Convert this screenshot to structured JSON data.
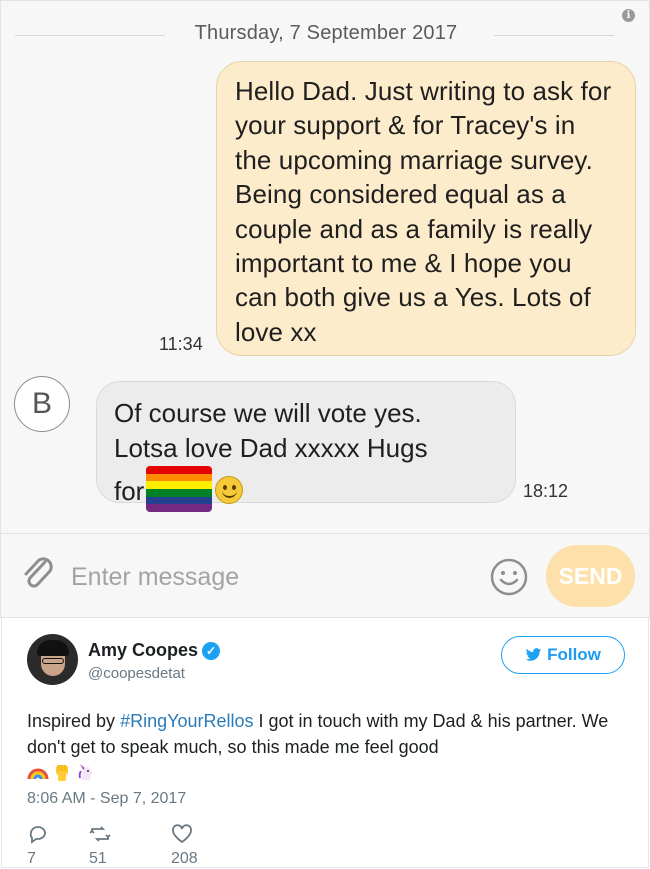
{
  "conversation": {
    "date_label": "Thursday, 7 September 2017",
    "outgoing": {
      "text": "Hello Dad. Just writing to ask for your support & for Tracey's in the upcoming marriage survey. Being considered equal as a couple and as a family is really important to me & I hope you can both give us a Yes. Lots of love xx",
      "time": "11:34"
    },
    "incoming": {
      "avatar_letter": "B",
      "text_line1": "Of course  we will  vote yes.",
      "text_line2": "Lotsa  love Dad xxxxx Hugs",
      "text_line3": "for",
      "emojis": [
        "rainbow-flag",
        "slightly-smiling-face"
      ],
      "time": "18:12"
    },
    "compose": {
      "placeholder": "Enter message",
      "send_label": "SEND"
    },
    "colors": {
      "outgoing_bubble": "#fdeccb",
      "incoming_bubble": "#ececec",
      "send_button": "#fde0aa"
    }
  },
  "tweet": {
    "author_name": "Amy Coopes",
    "author_handle": "@coopesdetat",
    "verified": true,
    "follow_label": "Follow",
    "text_before": "Inspired by ",
    "hashtag": "#RingYourRellos",
    "text_after": " I got in touch with my Dad & his partner. We don't get to speak much, so this made me feel good",
    "emojis": [
      "rainbow",
      "raised-fist",
      "unicorn"
    ],
    "timestamp": "8:06 AM - Sep 7, 2017",
    "replies": "7",
    "retweets": "51",
    "likes": "208",
    "colors": {
      "link": "#2b7bb9",
      "follow_border": "#1da1f2"
    }
  }
}
